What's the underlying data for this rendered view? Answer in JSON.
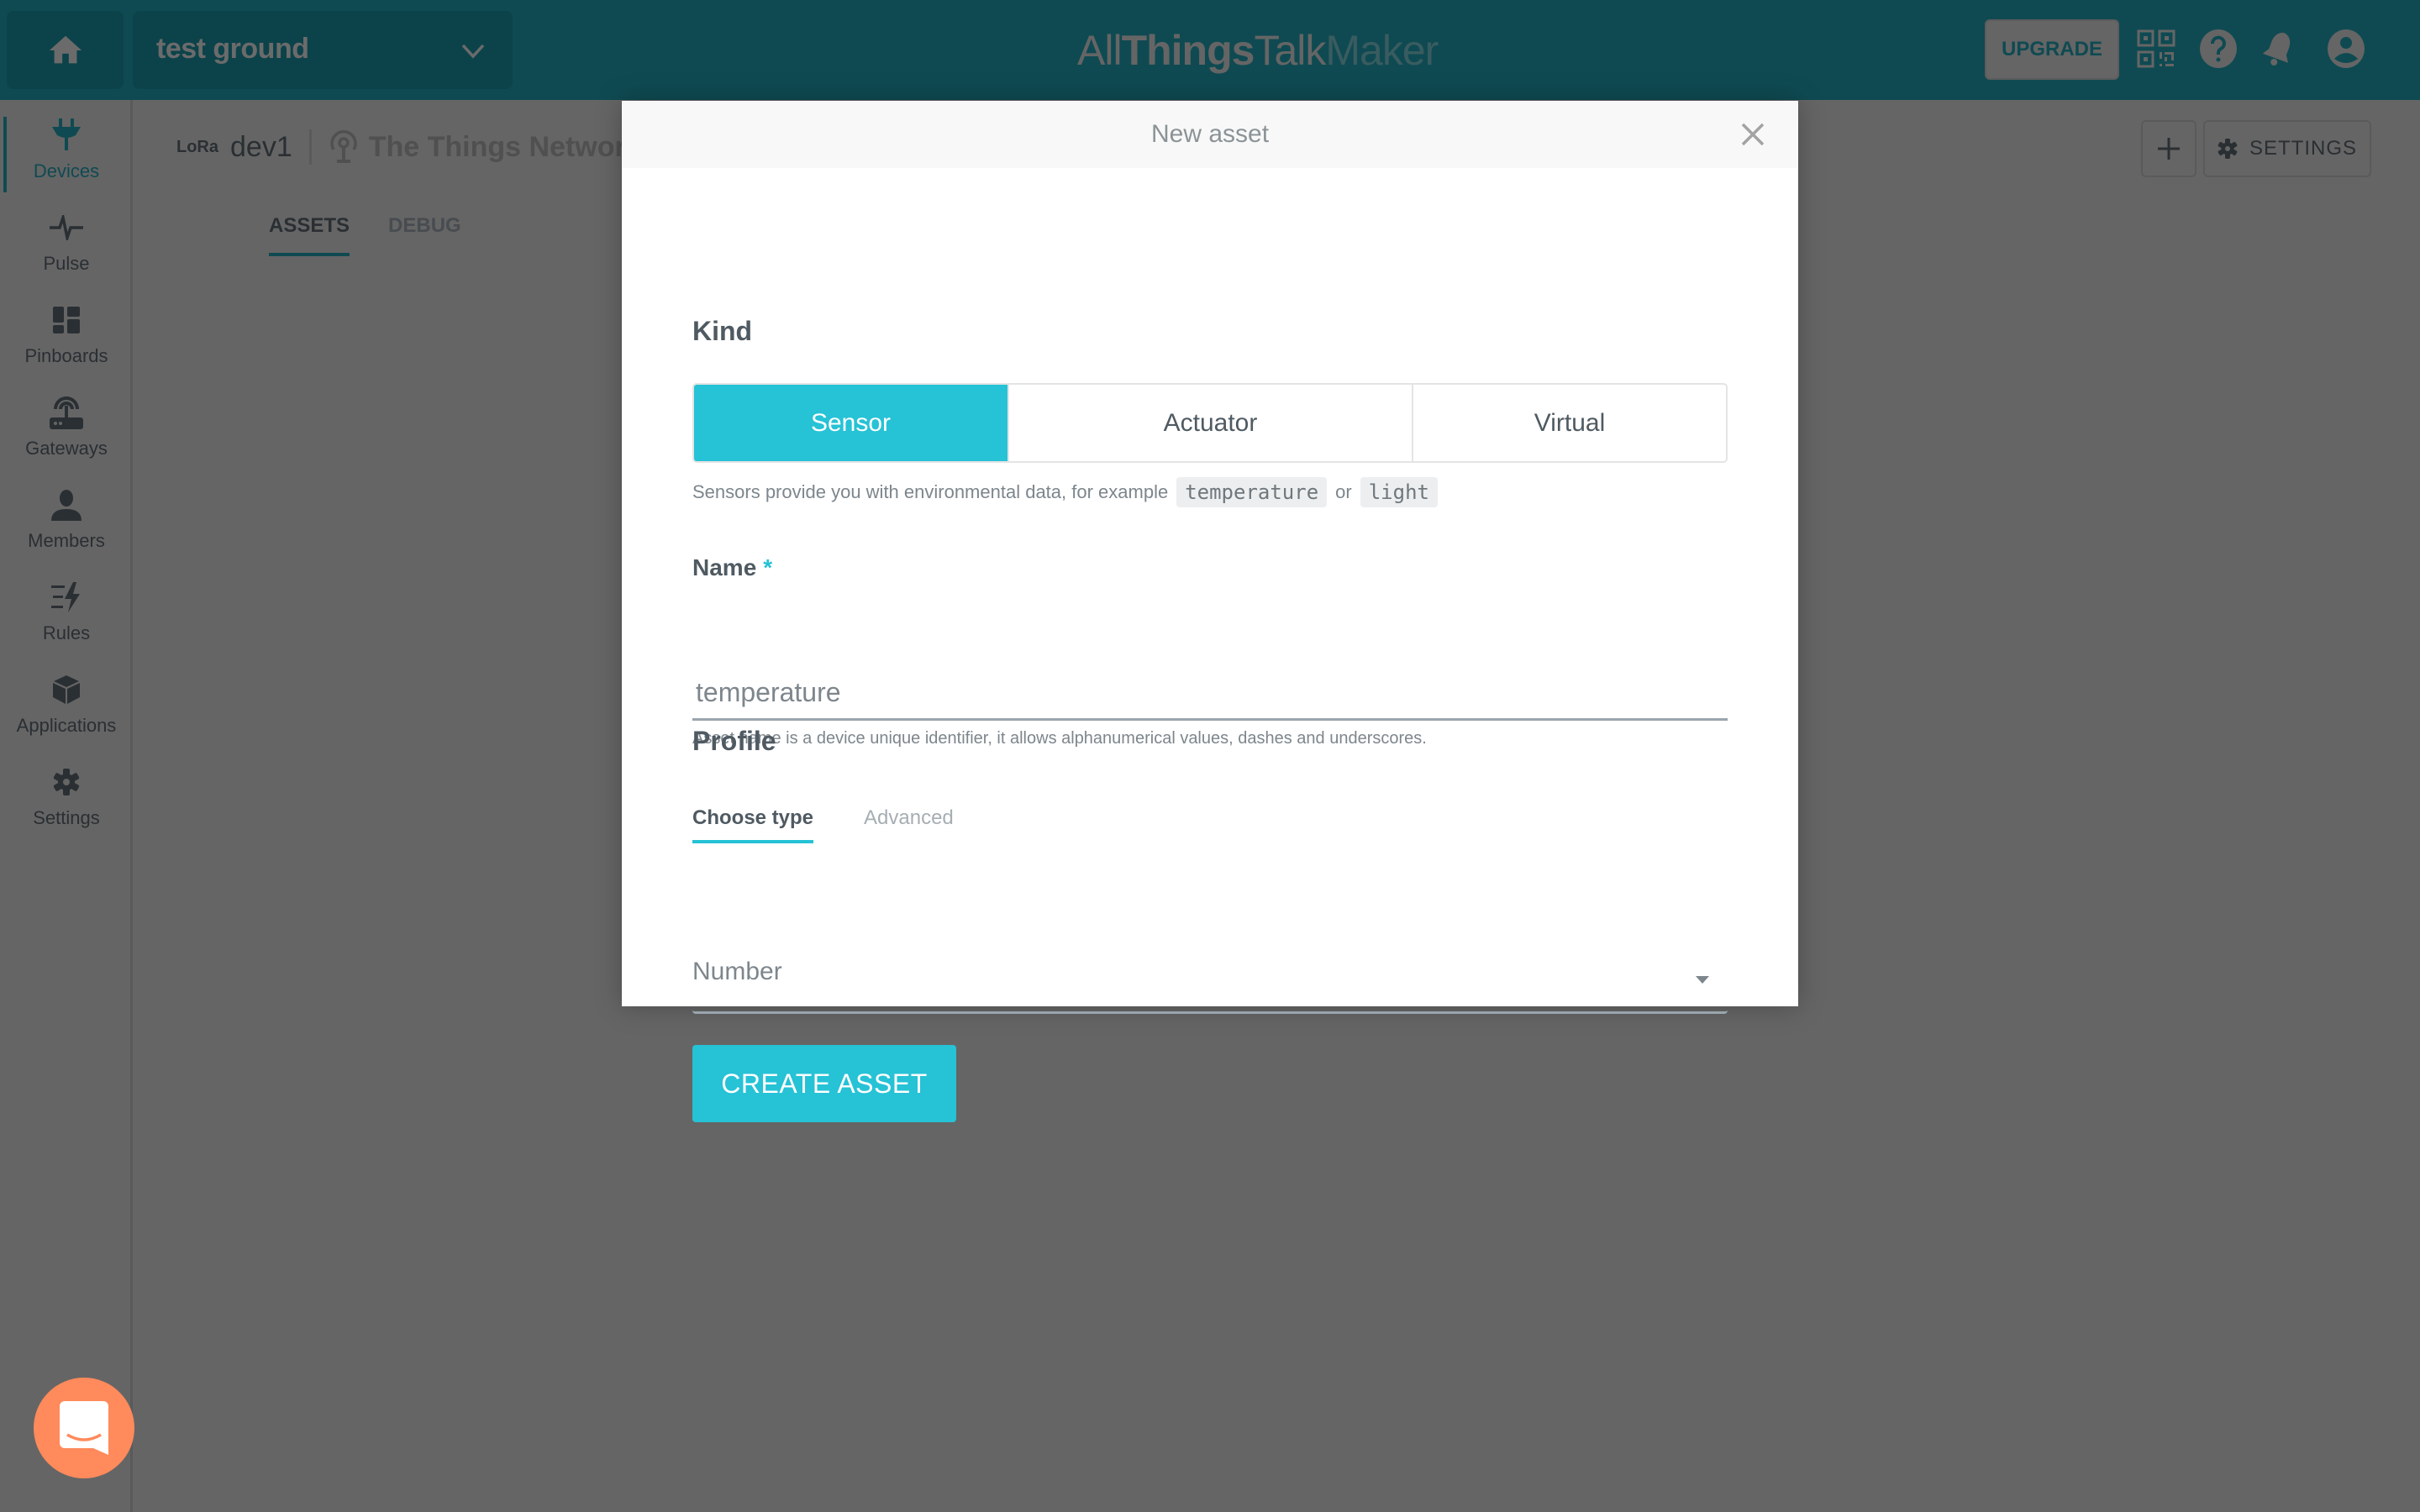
{
  "header": {
    "workspace_name": "test ground",
    "logo": {
      "part1": "All",
      "part2": "Things",
      "part3": "Talk",
      "part4": "Maker"
    },
    "upgrade_label": "UPGRADE",
    "icons": [
      "home-icon",
      "chevron-down-icon",
      "qr-code-icon",
      "help-icon",
      "bell-icon",
      "account-icon"
    ]
  },
  "sidebar": {
    "items": [
      {
        "label": "Devices",
        "icon": "plug-icon",
        "active": true
      },
      {
        "label": "Pulse",
        "icon": "pulse-icon",
        "active": false
      },
      {
        "label": "Pinboards",
        "icon": "dashboard-icon",
        "active": false
      },
      {
        "label": "Gateways",
        "icon": "router-icon",
        "active": false
      },
      {
        "label": "Members",
        "icon": "user-icon",
        "active": false
      },
      {
        "label": "Rules",
        "icon": "rules-bolt-icon",
        "active": false
      },
      {
        "label": "Applications",
        "icon": "cube-icon",
        "active": false
      },
      {
        "label": "Settings",
        "icon": "gear-icon",
        "active": false
      }
    ]
  },
  "device": {
    "lora_badge": "LoRa",
    "name": "dev1",
    "network": "The Things Network",
    "tabs": [
      {
        "label": "ASSETS",
        "active": true
      },
      {
        "label": "DEBUG",
        "active": false
      }
    ],
    "settings_label": "SETTINGS"
  },
  "modal": {
    "title": "New asset",
    "kind": {
      "title": "Kind",
      "options": [
        "Sensor",
        "Actuator",
        "Virtual"
      ],
      "selected": "Sensor",
      "helper_prefix": "Sensors provide you with environmental data, for example",
      "helper_example1": "temperature",
      "helper_or": "or",
      "helper_example2": "light"
    },
    "name": {
      "label": "Name",
      "required_mark": "*",
      "placeholder": "temperature",
      "value": "",
      "helper": "Asset name is a device unique identifier, it allows alphanumerical values, dashes and underscores."
    },
    "profile": {
      "title": "Profile",
      "tabs": [
        {
          "label": "Choose type",
          "active": true
        },
        {
          "label": "Advanced",
          "active": false
        }
      ],
      "type_selected": "Number"
    },
    "create_label": "CREATE ASSET"
  },
  "colors": {
    "accent": "#26c2d6",
    "header": "#0f4a52",
    "chat_launcher": "#ff8a5b"
  }
}
